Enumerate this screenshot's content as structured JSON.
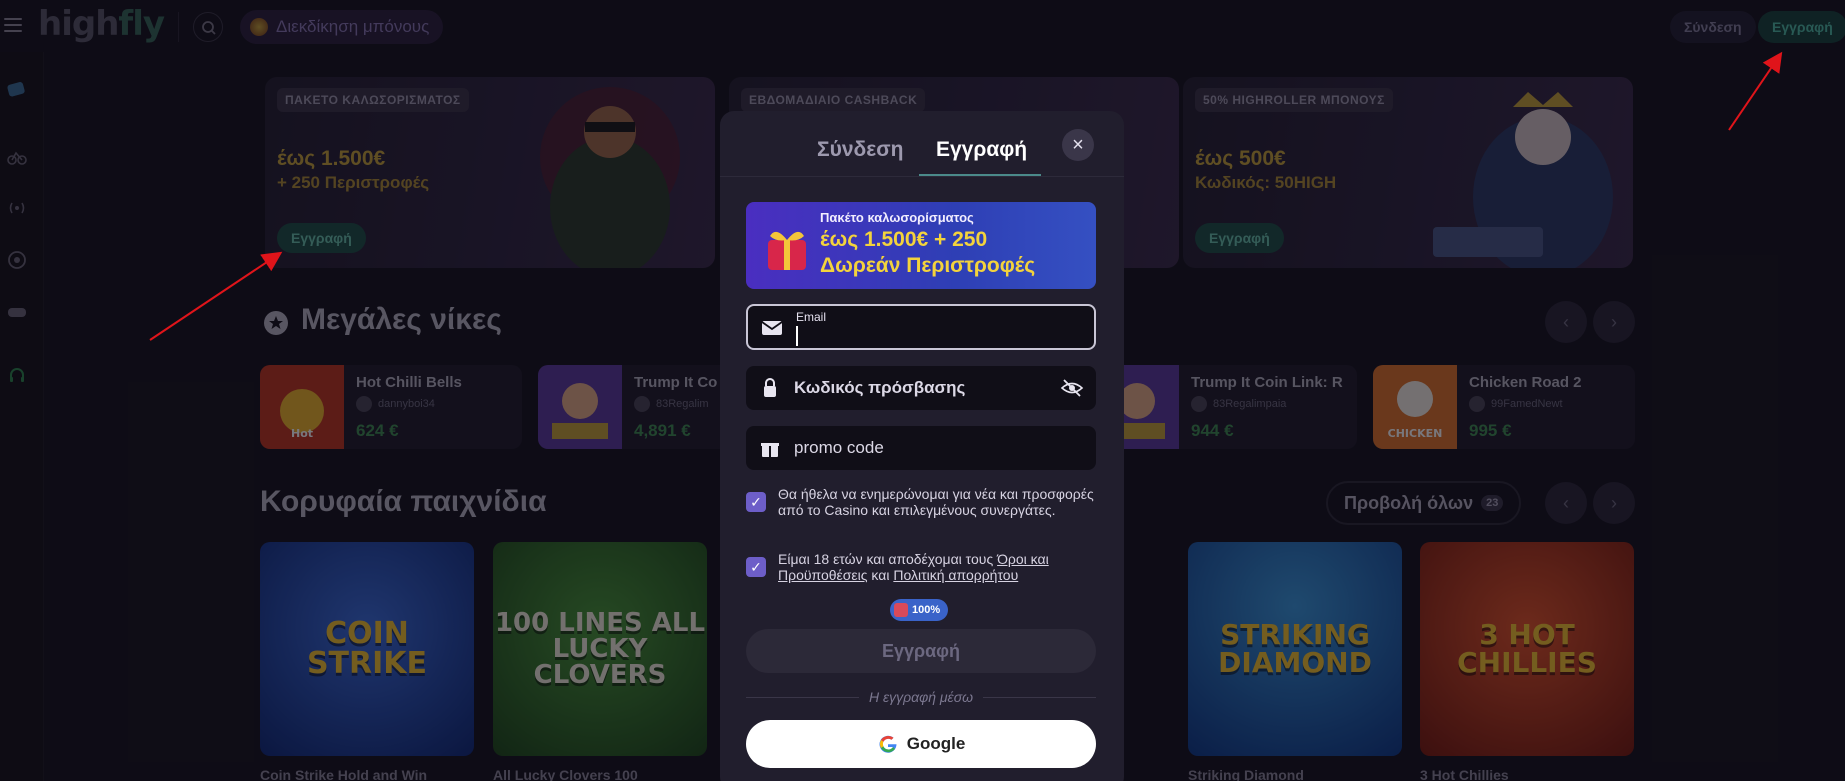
{
  "header": {
    "logo_high": "high",
    "logo_fly": "fly",
    "bonus_label": "Διεκδίκηση μπόνους",
    "login_label": "Σύνδεση",
    "register_label": "Εγγραφή"
  },
  "banners": [
    {
      "tag": "ΠΑΚΕΤΟ ΚΑΛΩΣΟΡΙΣΜΑΤΟΣ",
      "amount": "έως 1.500€",
      "sub": "+ 250 Περιστροφές",
      "cta": "Εγγραφή"
    },
    {
      "tag": "ΕΒΔΟΜΑΔΙΑΙΟ CASHBACK"
    },
    {
      "tag": "50% HIGHROLLER ΜΠΟΝΟΥΣ",
      "amount": "έως 500€",
      "sub": "Κωδικός: 50HIGH",
      "cta": "Εγγραφή"
    }
  ],
  "big_wins": {
    "title": "Μεγάλες νίκες",
    "items": [
      {
        "name": "Hot Chilli Bells",
        "user": "dannyboi34",
        "amount": "624 €"
      },
      {
        "name": "Trump It Co",
        "user": "83Regalim",
        "amount": "4,891 €"
      },
      {
        "name": "Trump It Coin Link: R",
        "user": "83Regalimpaia",
        "amount": "944 €"
      },
      {
        "name": "Chicken Road 2",
        "user": "99FamedNewt",
        "amount": "995 €"
      }
    ]
  },
  "top_games": {
    "title": "Κορυφαία παιχνίδια",
    "view_all": "Προβολή όλων",
    "count": "23",
    "tiles": [
      {
        "art": "COIN STRIKE",
        "caption": "Coin Strike Hold and Win"
      },
      {
        "art": "100 LINES ALL LUCKY CLOVERS",
        "caption": "All Lucky Clovers 100"
      },
      {
        "art": "STRIKING DIAMOND",
        "caption": "Striking Diamond"
      },
      {
        "art": "3 HOT CHILLIES",
        "caption": "3 Hot Chillies"
      }
    ]
  },
  "modal": {
    "tab_login": "Σύνδεση",
    "tab_register": "Εγγραφή",
    "promo_line1": "Πακέτο καλωσορίσματος",
    "promo_line2": "έως 1.500€ + 250",
    "promo_line3": "Δωρεάν Περιστροφές",
    "email_label": "Email",
    "email_value": "",
    "password_placeholder": "Κωδικός πρόσβασης",
    "promo_placeholder": "promo code",
    "newsletter_text": "Θα ήθελα να ενημερώνομαι για νέα και προσφορές από το Casino και επιλεγμένους συνεργάτες.",
    "terms_prefix": "Είμαι 18 ετών και αποδέχομαι τους ",
    "terms_link": "Όροι και Προϋποθέσεις",
    "terms_and": " και ",
    "privacy_link": "Πολιτική απορρήτου",
    "progress_label": "100%",
    "submit_label": "Εγγραφή",
    "or_label": "Η εγγραφή μέσω",
    "google_label": "Google"
  },
  "colors": {
    "accent_teal": "#17443d",
    "checkbox": "#6d5ec8",
    "annotation_arrow": "#e0141a"
  }
}
